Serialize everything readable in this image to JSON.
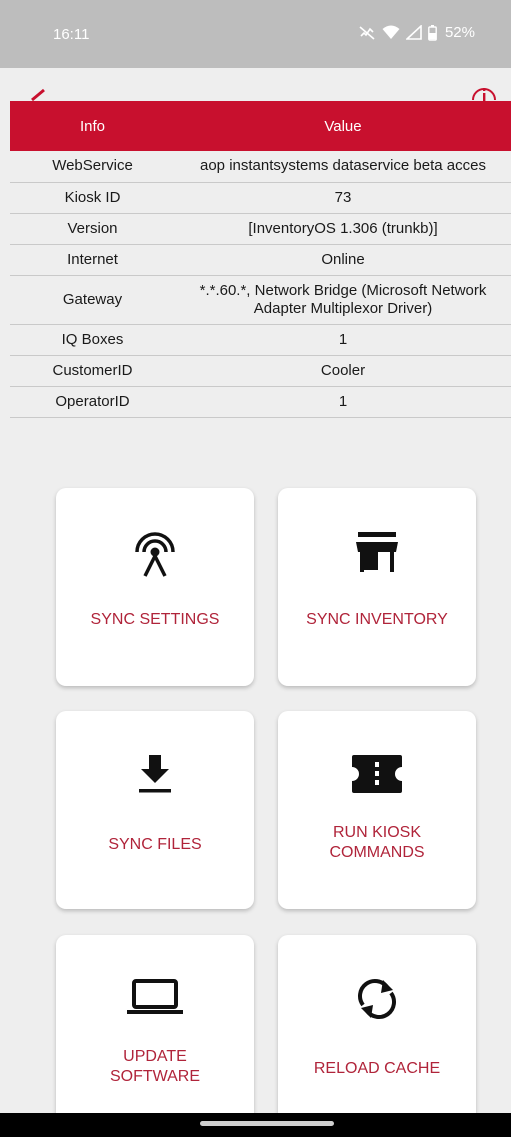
{
  "status_bar": {
    "time": "16:11",
    "battery": "52%",
    "icons": [
      "mute-icon",
      "wifi-icon",
      "signal-icon",
      "battery-icon"
    ]
  },
  "app_bar": {
    "icons": [
      "back-arrow-icon",
      "info-icon"
    ]
  },
  "colors": {
    "accent": "#c8102e",
    "card_label": "#b0243a",
    "background": "#eeeeee"
  },
  "table": {
    "headers": [
      "Info",
      "Value"
    ],
    "rows": [
      {
        "info": "WebService",
        "value": "aop instantsystems dataservice beta acces"
      },
      {
        "info": "Kiosk ID",
        "value": "73"
      },
      {
        "info": "Version",
        "value": "[InventoryOS 1.306 (trunkb)]"
      },
      {
        "info": "Internet",
        "value": "Online"
      },
      {
        "info": "Gateway",
        "value": "*.*.60.*, Network Bridge (Microsoft Network Adapter Multiplexor Driver)"
      },
      {
        "info": "IQ Boxes",
        "value": "1"
      },
      {
        "info": "CustomerID",
        "value": "Cooler"
      },
      {
        "info": "OperatorID",
        "value": "1"
      }
    ]
  },
  "actions": [
    {
      "label": "SYNC SETTINGS",
      "icon": "antenna-icon"
    },
    {
      "label": "SYNC INVENTORY",
      "icon": "store-icon"
    },
    {
      "label": "SYNC FILES",
      "icon": "download-icon"
    },
    {
      "label": "RUN KIOSK COMMANDS",
      "icon": "ticket-icon"
    },
    {
      "label": "UPDATE SOFTWARE",
      "icon": "laptop-icon"
    },
    {
      "label": "RELOAD CACHE",
      "icon": "sync-icon"
    }
  ]
}
